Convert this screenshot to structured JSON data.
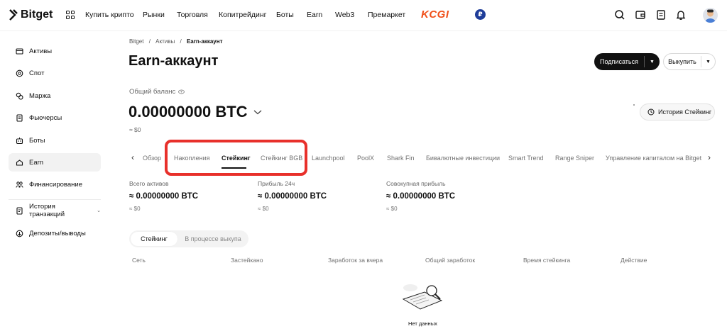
{
  "brand": {
    "name": "Bitget",
    "partner_logo": "KCGI",
    "currency_badge": "₽"
  },
  "topnav": {
    "items": [
      "Купить крипто",
      "Рынки",
      "Торговля",
      "Копитрейдинг",
      "Боты",
      "Earn",
      "Web3",
      "Премаркет"
    ],
    "icons": [
      "search-icon",
      "wallet-icon",
      "orders-icon",
      "bell-icon",
      "avatar"
    ]
  },
  "sidebar": {
    "items": [
      {
        "label": "Активы",
        "icon": "assets-icon"
      },
      {
        "label": "Спот",
        "icon": "spot-icon"
      },
      {
        "label": "Маржа",
        "icon": "margin-icon"
      },
      {
        "label": "Фьючерсы",
        "icon": "futures-icon"
      },
      {
        "label": "Боты",
        "icon": "bots-icon"
      },
      {
        "label": "Earn",
        "icon": "earn-icon"
      },
      {
        "label": "Финансирование",
        "icon": "financing-icon"
      },
      {
        "label": "История транзакций",
        "icon": "history-icon"
      },
      {
        "label": "Депозиты/выводы",
        "icon": "deposit-icon"
      }
    ],
    "active": "Earn"
  },
  "breadcrumb": {
    "items": [
      "Bitget",
      "Активы",
      "Earn-аккаунт"
    ],
    "separator": "/"
  },
  "page": {
    "title": "Earn-аккаунт",
    "subscribe_label": "Подписаться",
    "redeem_label": "Выкупить",
    "balance_label": "Общий баланс",
    "balance_value": "0.00000000 BTC",
    "balance_fiat": "≈ $0",
    "history_label": "История Стейкинг"
  },
  "tabs": {
    "items": [
      "Обзор",
      "Накопления",
      "Стейкинг",
      "Стейкинг BGB",
      "Launchpool",
      "PoolX",
      "Shark Fin",
      "Бивалютные инвестиции",
      "Smart Trend",
      "Range Sniper",
      "Управление капиталом на Bitget"
    ],
    "active": "Стейкинг"
  },
  "stats": [
    {
      "label": "Всего активов",
      "value": "≈ 0.00000000 BTC",
      "fiat": "≈ $0"
    },
    {
      "label": "Прибыль 24ч",
      "value": "≈ 0.00000000 BTC",
      "fiat": "≈ $0"
    },
    {
      "label": "Совокупная прибыль",
      "value": "≈ 0.00000000 BTC",
      "fiat": "≈ $0"
    }
  ],
  "segment": {
    "options": [
      "Стейкинг",
      "В процессе выкупа"
    ],
    "selected": "Стейкинг"
  },
  "table": {
    "columns": [
      "Сеть",
      "Застейкано",
      "Заработок за вчера",
      "Общий заработок",
      "Время стейкинга",
      "Действие"
    ],
    "empty_text": "Нет данных"
  },
  "colors": {
    "accent": "#111111",
    "highlight": "#e8302b",
    "kcgi": "#f0501a",
    "badge": "#1f3d99"
  }
}
